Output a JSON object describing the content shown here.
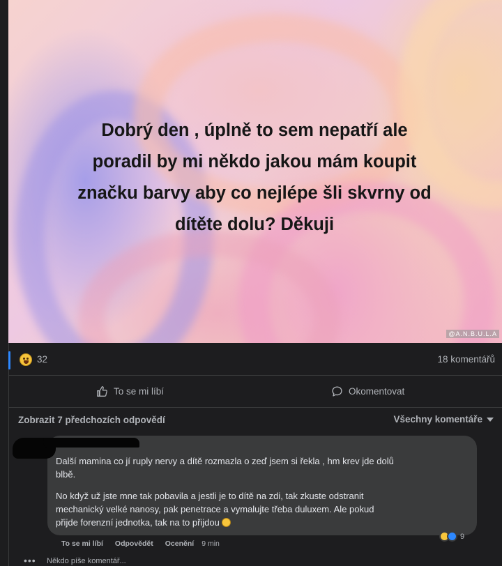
{
  "post": {
    "image_text_lines": [
      "Dobrý den , úplně to sem nepatří ale",
      "poradil by mi někdo jakou mám koupit",
      "značku barvy aby co nejlépe šli skvrny od",
      "dítěte dolu? Děkuji"
    ],
    "watermark": "@A.N.B.U.L.A"
  },
  "stats": {
    "reaction_icon": "haha-emoji-icon",
    "reaction_count": "32",
    "comment_count": "18 komentářů"
  },
  "actions": {
    "like_label": "To se mi líbí",
    "like_icon": "thumbs-up-icon",
    "comment_label": "Okomentovat",
    "comment_icon": "speech-bubble-icon"
  },
  "comments_header": {
    "previous_replies": "Zobrazit 7 předchozích odpovědí",
    "filter_label": "Všechny komentáře"
  },
  "comment": {
    "paragraph1_lines": [
      "Další mamina co jí ruply nervy a dítě rozmazla o zeď jsem si řekla , hm krev jde dolů",
      "blbě."
    ],
    "paragraph2_lines": [
      "No když už jste mne tak pobavila a jestli je to dítě na zdi, tak zkuste odstranit",
      "mechanický velké nanosy, pak penetrace a vymalujte třeba duluxem. Ale pokud",
      "přijde forenzní jednotka, tak na to přijdou"
    ],
    "meta": {
      "like": "To se mi líbí",
      "reply": "Odpovědět",
      "rate": "Ocenění",
      "time": "9 min"
    },
    "reaction_count": "9"
  },
  "typing": {
    "dots": "•••",
    "text": "Někdo píše komentář..."
  },
  "colors": {
    "background": "#1d1d1f",
    "bubble": "#3a3b3c",
    "secondary_text": "#b0b3b8",
    "accent_blue": "#2d88ff",
    "emoji_yellow": "#f7c53c"
  }
}
